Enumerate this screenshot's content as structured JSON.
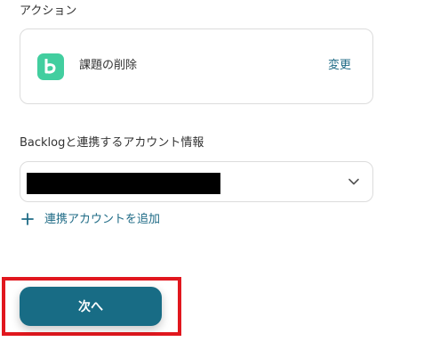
{
  "action_section": {
    "label": "アクション",
    "app_icon": "backlog-icon",
    "action_name": "課題の削除",
    "change_label": "変更"
  },
  "account_section": {
    "label": "Backlogと連携するアカウント情報",
    "selected_value": "",
    "add_account_label": "連携アカウントを追加"
  },
  "footer": {
    "next_label": "次へ"
  },
  "colors": {
    "accent": "#1f6b86",
    "primary_button": "#186c85",
    "backlog_green": "#42ce9f",
    "highlight_red": "#e1171e"
  }
}
